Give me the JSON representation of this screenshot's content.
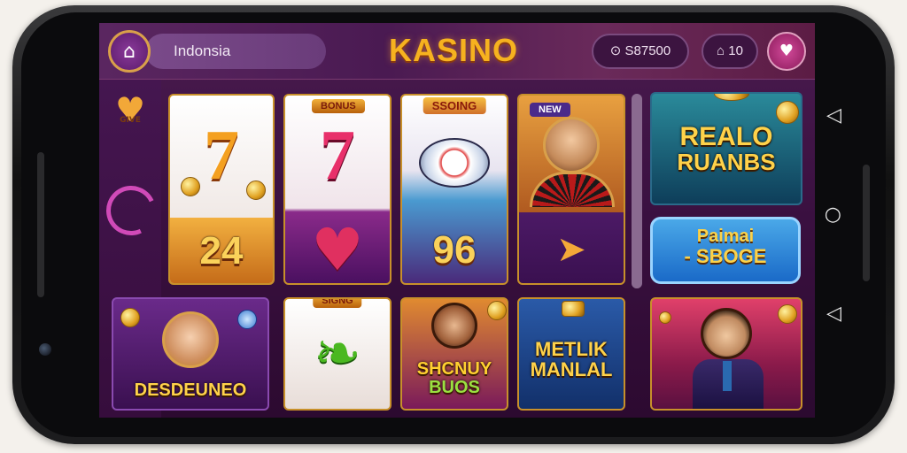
{
  "header": {
    "menu_icon": "home-icon",
    "region": "Indonsia",
    "brand": "KASINO",
    "balance": "S87500",
    "notifications": "10",
    "profile_icon": "profile-icon"
  },
  "sidebar": {
    "badge_text": "GIVE",
    "spinner_icon": "loading-spinner-icon"
  },
  "tiles": {
    "slot7_gold": {
      "symbol": "7",
      "number": "24"
    },
    "slot7_red": {
      "symbol": "7",
      "ribbon": "BONUS"
    },
    "sushi": {
      "ribbon": "SSOING",
      "number": "96"
    },
    "roulette": {
      "ribbon": "NEW"
    },
    "realo": {
      "title_line1": "REALO",
      "title_line2": "RUANBS"
    },
    "promo": {
      "line1": "Paimai",
      "line2": "- SBOGE"
    },
    "desdeuneo": {
      "title": "DESDEUNEO"
    },
    "leaf": {
      "ribbon": "SIGNG"
    },
    "shcnuy": {
      "title_line1": "SHCNUY",
      "title_line2": "BUOS"
    },
    "metlik": {
      "title_line1": "METLIK",
      "title_line2": "MANLAL"
    },
    "agent": {}
  },
  "colors": {
    "brand": "#f6b21f",
    "background": "#3a1040",
    "accent": "#d04ab8"
  }
}
